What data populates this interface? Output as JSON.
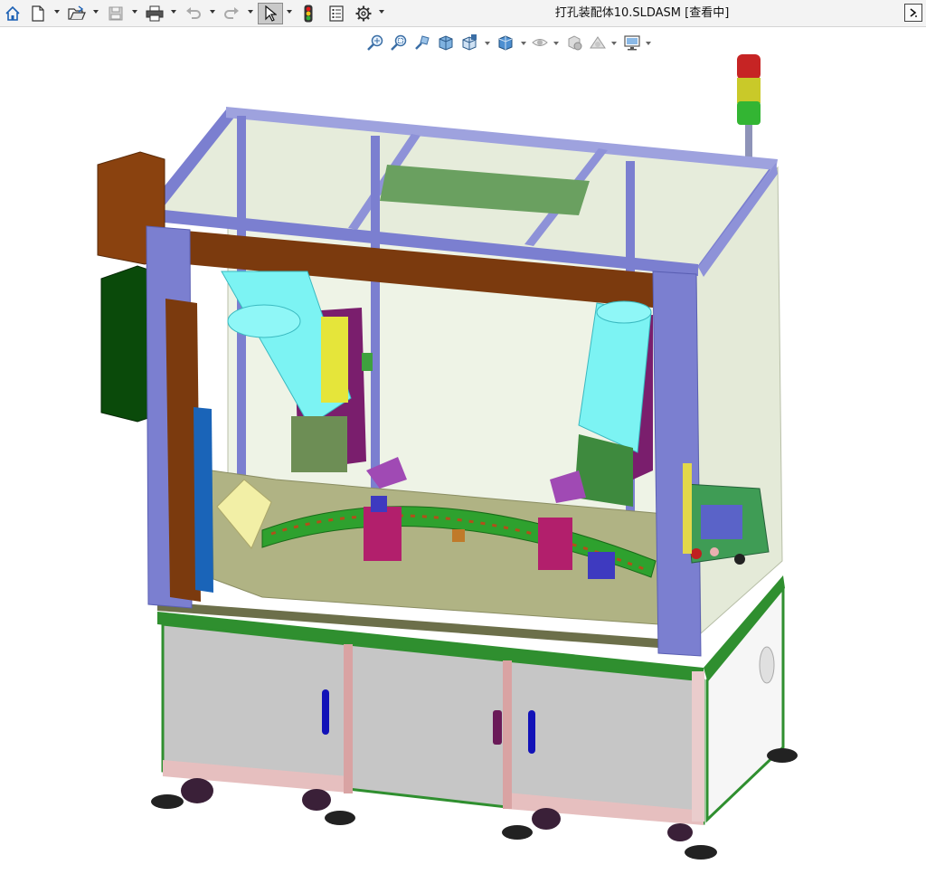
{
  "app": {
    "document_title": "打孔装配体10.SLDASM [查看中]"
  },
  "toolbar": {
    "items": [
      {
        "name": "home-icon"
      },
      {
        "name": "new-document-icon"
      },
      {
        "name": "open-icon"
      },
      {
        "name": "save-icon"
      },
      {
        "name": "print-icon"
      },
      {
        "name": "undo-icon"
      },
      {
        "name": "redo-icon"
      },
      {
        "name": "select-icon"
      },
      {
        "name": "traffic-light-icon"
      },
      {
        "name": "file-properties-icon"
      },
      {
        "name": "options-gear-icon"
      }
    ],
    "expand_icon": "expand-arrow-icon"
  },
  "view_toolbar": {
    "items": [
      {
        "name": "zoom-to-fit-icon"
      },
      {
        "name": "zoom-to-area-icon"
      },
      {
        "name": "previous-view-icon"
      },
      {
        "name": "section-view-icon"
      },
      {
        "name": "view-orientation-icon"
      },
      {
        "name": "display-style-icon"
      },
      {
        "name": "hide-show-items-icon"
      },
      {
        "name": "edit-appearance-icon"
      },
      {
        "name": "apply-scene-icon"
      },
      {
        "name": "view-settings-icon"
      }
    ]
  },
  "colors": {
    "frame_profile": "#7b7fd0",
    "frame_profile_dark": "#5a5fb3",
    "glass": "#e7eee0",
    "rust_bar": "#7b3a0e",
    "table_top": "#b2b58a",
    "cabinet_door": "#c6c6c6",
    "base_frame": "#2f8f2f",
    "cylinder": "#7cf3f3",
    "green_part": "#2ea12e",
    "electrical_box": "#0a4a0a",
    "hmi_panel": "#3f9c55"
  }
}
